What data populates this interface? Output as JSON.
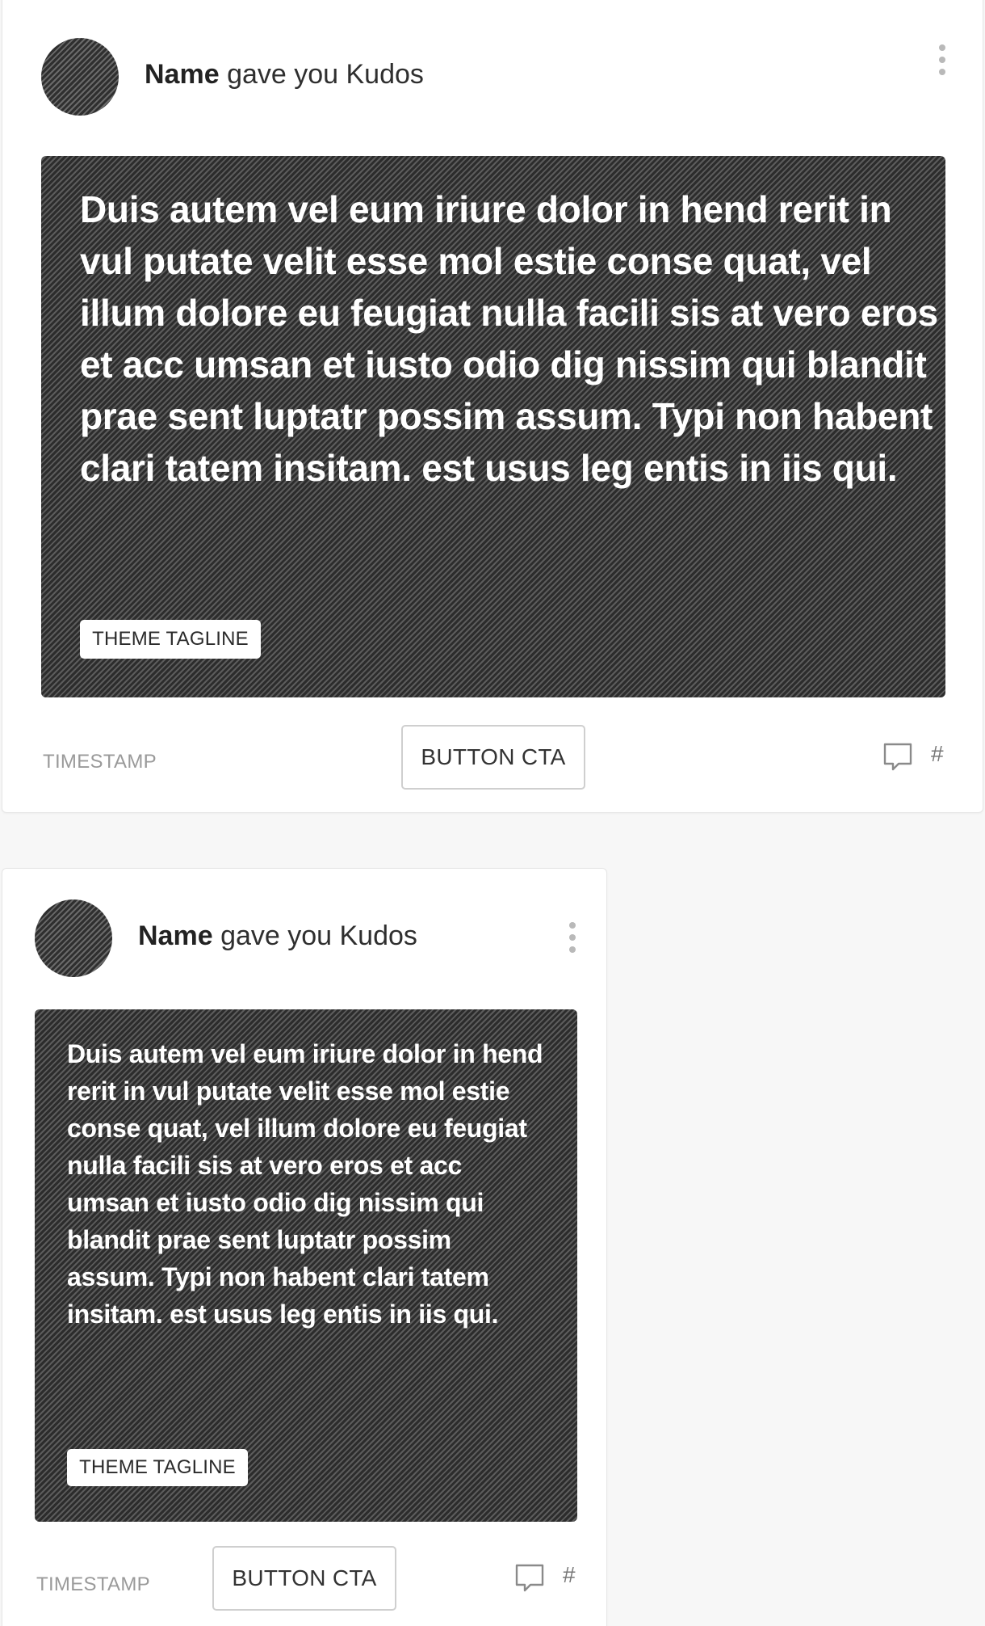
{
  "feed": {
    "cards": [
      {
        "author": "Name",
        "action": "gave you Kudos",
        "quote": "Duis autem vel eum iriure dolor in hend rerit in vul putate velit esse mol estie conse quat, vel illum dolore eu feugiat nulla facili sis at vero eros et acc umsan et iusto odio dig nissim qui blandit prae sent luptatr possim assum. Typi non habent clari tatem insitam. est usus leg entis in iis qui.",
        "tagline": "THEME TAGLINE",
        "timestamp": "TIMESTAMP",
        "cta_label": "BUTTON CTA",
        "comment_count": "#"
      },
      {
        "author": "Name",
        "action": "gave you Kudos",
        "quote": "Duis autem vel eum iriure dolor in hend rerit in vul putate velit esse mol estie conse quat, vel illum dolore eu feugiat nulla facili sis at vero eros et acc umsan et iusto odio dig nissim qui blandit prae sent luptatr possim assum. Typi non habent clari tatem insitam. est usus leg entis in iis qui.",
        "tagline": "THEME TAGLINE",
        "timestamp": "TIMESTAMP",
        "cta_label": "BUTTON CTA",
        "comment_count": "#"
      }
    ]
  },
  "icons": {
    "more": "kebab-vertical-icon",
    "comment": "speech-bubble-icon"
  },
  "colors": {
    "media_bg": "#2c2c2c",
    "text_muted": "#9a9a9a",
    "border": "#cfcfcf"
  }
}
